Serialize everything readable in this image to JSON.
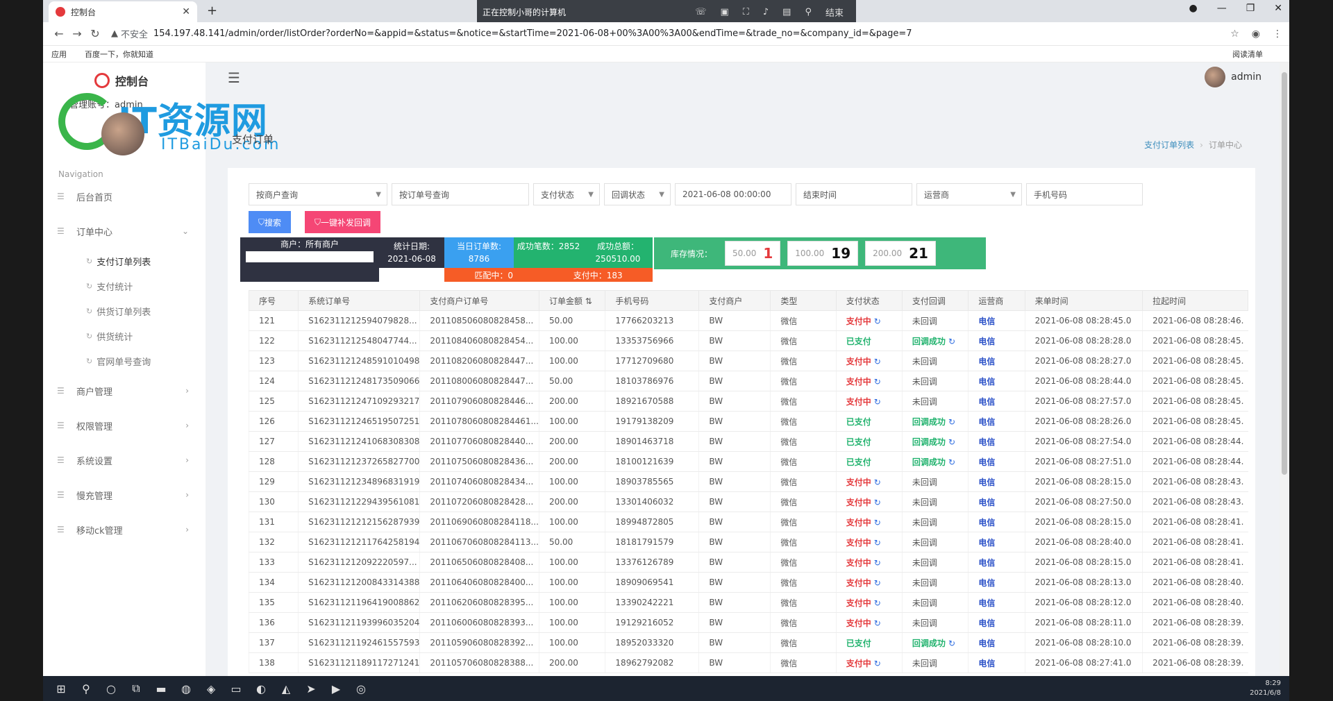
{
  "browser": {
    "tab_title": "控制台",
    "remote_title": "正在控制小哥的计算机",
    "remote_end": "结束",
    "insecure": "不安全",
    "url": "154.197.48.141/admin/order/listOrder?orderNo=&appid=&status=&notice=&startTime=2021-06-08+00%3A00%3A00&endTime=&trade_no=&company_id=&page=7",
    "bookmarks": [
      "应用",
      "百度一下，你就知道"
    ],
    "reading_list": "阅读清单"
  },
  "app": {
    "brand": "控制台",
    "admin_label": "管理账号：admin",
    "watermark_main": "IT资源网",
    "watermark_sub": "ITBaiDu.com",
    "user": "admin",
    "nav_caption": "Navigation",
    "menu": [
      {
        "label": "后台首页"
      },
      {
        "label": "订单中心"
      },
      {
        "label": "商户管理"
      },
      {
        "label": "权限管理"
      },
      {
        "label": "系统设置"
      },
      {
        "label": "慢充管理"
      },
      {
        "label": "移动ck管理"
      }
    ],
    "submenu": [
      "支付订单列表",
      "支付统计",
      "供货订单列表",
      "供货统计",
      "官网单号查询"
    ],
    "page_title": "支付订单",
    "breadcrumb": [
      "支付订单列表",
      "订单中心"
    ]
  },
  "filters": {
    "merchant": "按商户查询",
    "order_no": "按订单号查询",
    "pay_status": "支付状态",
    "callback_status": "回调状态",
    "start_time": "2021-06-08 00:00:00",
    "end_time": "结束时间",
    "operator": "运营商",
    "phone": "手机号码",
    "search_btn": "搜索",
    "redo_btn": "一键补发回调"
  },
  "stats": {
    "merchant": "商户：所有商户",
    "date_label": "统计日期:",
    "date": "2021-06-08",
    "today_label": "当日订单数:",
    "today": "8786",
    "success_label": "成功笔数：2852",
    "amount_label": "成功总额：",
    "amount": "250510.00",
    "matching": "匹配中：0",
    "paying": "支付中：183",
    "stock_label": "库存情况：",
    "stock": [
      {
        "amount": "50.00",
        "count": "1",
        "red": true
      },
      {
        "amount": "100.00",
        "count": "19",
        "red": false
      },
      {
        "amount": "200.00",
        "count": "21",
        "red": false
      }
    ]
  },
  "table": {
    "headers": [
      "序号",
      "系统订单号",
      "支付商户订单号",
      "订单金额",
      "手机号码",
      "支付商户",
      "类型",
      "支付状态",
      "支付回调",
      "运营商",
      "来单时间",
      "拉起时间"
    ],
    "rows": [
      [
        "121",
        "S16231121259407982​8...",
        "2011085060808284​58...",
        "50.00",
        "17766203213",
        "BW",
        "微信",
        "支付中",
        "未回调",
        "电信",
        "2021-06-08 08:28:45.0",
        "2021-06-08 08:28:46."
      ],
      [
        "122",
        "S162311212548047744...",
        "2011084060808284​54...",
        "100.00",
        "13353756966",
        "BW",
        "微信",
        "已支付",
        "回调成功",
        "电信",
        "2021-06-08 08:28:28.0",
        "2021-06-08 08:28:45."
      ],
      [
        "123",
        "S1623112124859101​0498",
        "2011082060808284​47...",
        "100.00",
        "17712709680",
        "BW",
        "微信",
        "支付中",
        "未回调",
        "电信",
        "2021-06-08 08:28:27.0",
        "2021-06-08 08:28:45."
      ],
      [
        "124",
        "S1623112124817350​9066",
        "2011080060808284​47...",
        "50.00",
        "18103786976",
        "BW",
        "微信",
        "支付中",
        "未回调",
        "电信",
        "2021-06-08 08:28:44.0",
        "2021-06-08 08:28:45."
      ],
      [
        "125",
        "S1623112124710929​3217",
        "2011079060808284​46...",
        "200.00",
        "18921670588",
        "BW",
        "微信",
        "支付中",
        "未回调",
        "电信",
        "2021-06-08 08:27:57.0",
        "2021-06-08 08:28:45."
      ],
      [
        "126",
        "S1623112124651950​7251",
        "2011078060808284​461...",
        "100.00",
        "19179138209",
        "BW",
        "微信",
        "已支付",
        "回调成功",
        "电信",
        "2021-06-08 08:28:26.0",
        "2021-06-08 08:28:45."
      ],
      [
        "127",
        "S1623112124106830​8308",
        "2011077060808284​40...",
        "200.00",
        "18901463718",
        "BW",
        "微信",
        "已支付",
        "回调成功",
        "电信",
        "2021-06-08 08:27:54.0",
        "2021-06-08 08:28:44."
      ],
      [
        "128",
        "S1623112123726582​7700",
        "2011075060808284​36...",
        "200.00",
        "18100121639",
        "BW",
        "微信",
        "已支付",
        "回调成功",
        "电信",
        "2021-06-08 08:27:51.0",
        "2021-06-08 08:28:44."
      ],
      [
        "129",
        "S1623112123489683​1919",
        "2011074060808284​34...",
        "100.00",
        "18903785565",
        "BW",
        "微信",
        "支付中",
        "未回调",
        "电信",
        "2021-06-08 08:28:15.0",
        "2021-06-08 08:28:43."
      ],
      [
        "130",
        "S1623112122943956​1081",
        "2011072060808284​28...",
        "200.00",
        "13301406032",
        "BW",
        "微信",
        "支付中",
        "未回调",
        "电信",
        "2021-06-08 08:27:50.0",
        "2021-06-08 08:28:43."
      ],
      [
        "131",
        "S1623112121215628​7939",
        "2011069060808284​118...",
        "100.00",
        "18994872805",
        "BW",
        "微信",
        "支付中",
        "未回调",
        "电信",
        "2021-06-08 08:28:15.0",
        "2021-06-08 08:28:41."
      ],
      [
        "132",
        "S1623112121176425​8194",
        "2011067060808284​113...",
        "50.00",
        "18181791579",
        "BW",
        "微信",
        "支付中",
        "未回调",
        "电信",
        "2021-06-08 08:28:40.0",
        "2021-06-08 08:28:41."
      ],
      [
        "133",
        "S16231121209222059​7...",
        "2011065060808284​08...",
        "100.00",
        "13376126789",
        "BW",
        "微信",
        "支付中",
        "未回调",
        "电信",
        "2021-06-08 08:28:15.0",
        "2021-06-08 08:28:41."
      ],
      [
        "134",
        "S1623112120084331​4388",
        "2011064060808284​00...",
        "100.00",
        "18909069541",
        "BW",
        "微信",
        "支付中",
        "未回调",
        "电信",
        "2021-06-08 08:28:13.0",
        "2021-06-08 08:28:40."
      ],
      [
        "135",
        "S1623112119641900​8862",
        "2011062060808283​95...",
        "100.00",
        "13390242221",
        "BW",
        "微信",
        "支付中",
        "未回调",
        "电信",
        "2021-06-08 08:28:12.0",
        "2021-06-08 08:28:40."
      ],
      [
        "136",
        "S1623112119399603​5204",
        "2011060060808283​93...",
        "100.00",
        "19129216052",
        "BW",
        "微信",
        "支付中",
        "未回调",
        "电信",
        "2021-06-08 08:28:11.0",
        "2021-06-08 08:28:39."
      ],
      [
        "137",
        "S1623112119246155​7593",
        "2011059060808283​92...",
        "100.00",
        "18952033320",
        "BW",
        "微信",
        "已支付",
        "回调成功",
        "电信",
        "2021-06-08 08:28:10.0",
        "2021-06-08 08:28:39."
      ],
      [
        "138",
        "S1623112118911727​1241",
        "2011057060808283​88...",
        "200.00",
        "18962792082",
        "BW",
        "微信",
        "支付中",
        "未回调",
        "电信",
        "2021-06-08 08:27:41.0",
        "2021-06-08 08:28:39."
      ]
    ]
  },
  "taskbar": {
    "time": "8:29",
    "date": "2021/6/8"
  }
}
